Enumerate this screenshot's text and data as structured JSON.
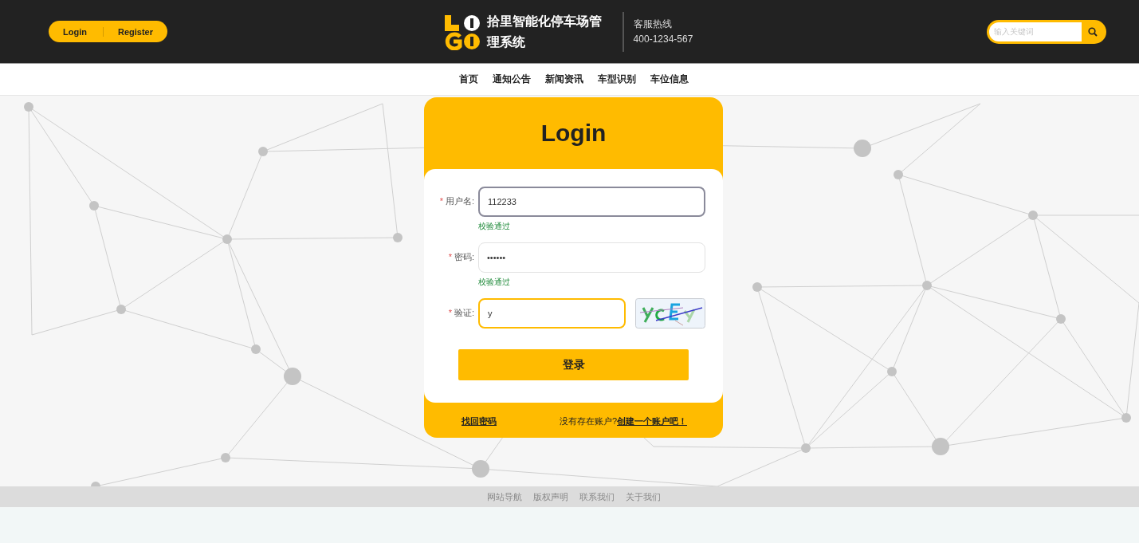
{
  "header": {
    "auth_links": [
      {
        "label": "Login"
      },
      {
        "label": "Register"
      }
    ],
    "site_title": "拾里智能化停车场管理系统",
    "hotline": {
      "label": "客服热线",
      "phone": "400-1234-567"
    },
    "search": {
      "placeholder": "输入关键词"
    }
  },
  "nav": {
    "items": [
      {
        "label": "首页"
      },
      {
        "label": "通知公告"
      },
      {
        "label": "新闻资讯"
      },
      {
        "label": "车型识别"
      },
      {
        "label": "车位信息"
      }
    ]
  },
  "login_form": {
    "title": "Login",
    "fields": [
      {
        "required_mark": "*",
        "label": "用户名:",
        "value": "112233",
        "hovered": true,
        "focused": false,
        "message": "校验通过",
        "kind": "text"
      },
      {
        "required_mark": "*",
        "label": "密码:",
        "value": "••••••",
        "hovered": false,
        "focused": false,
        "message": "校验通过",
        "kind": "text"
      },
      {
        "required_mark": "*",
        "label": "验证:",
        "value": "y",
        "hovered": false,
        "focused": true,
        "kind": "captcha"
      }
    ],
    "submit": "登录",
    "forgot_link": "找回密码",
    "register_prompt": "没有存在账户?",
    "register_link": "创建一个账户吧！"
  },
  "footer": {
    "links": [
      {
        "label": "网站导航"
      },
      {
        "label": "版权声明"
      },
      {
        "label": "联系我们"
      },
      {
        "label": "关于我们"
      }
    ]
  }
}
